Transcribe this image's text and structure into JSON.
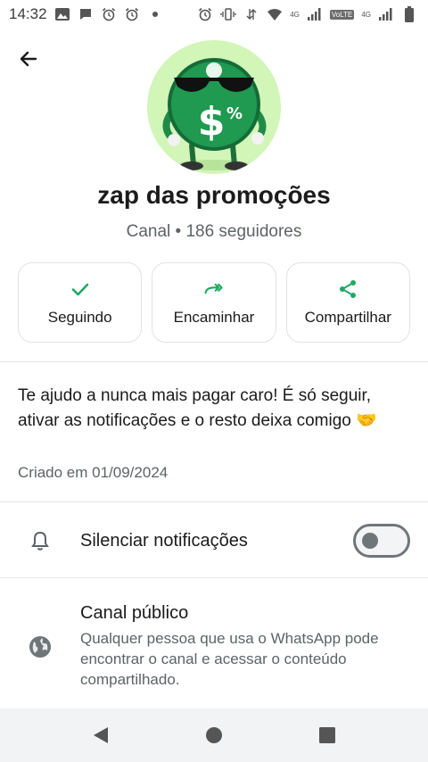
{
  "status_bar": {
    "time": "14:32",
    "network_left": "4G",
    "volte": "VoLTE",
    "network_right": "4G"
  },
  "channel": {
    "name": "zap das promoções",
    "meta": "Canal • 186 seguidores",
    "description": "Te ajudo a nunca mais pagar caro! É só seguir, ativar as notificações e o resto deixa comigo 🤝",
    "created": "Criado em 01/09/2024"
  },
  "actions": {
    "following_label": "Seguindo",
    "forward_label": "Encaminhar",
    "share_label": "Compartilhar"
  },
  "mute": {
    "label": "Silenciar notificações",
    "enabled": false
  },
  "public": {
    "title": "Canal público",
    "description": "Qualquer pessoa que usa o WhatsApp pode encontrar o canal e acessar o conteúdo compartilhado."
  },
  "icons": {
    "back": "arrow-left-icon",
    "following": "check-icon",
    "forward": "double-forward-icon",
    "share": "share-icon",
    "mute": "bell-icon",
    "public": "globe-icon"
  },
  "colors": {
    "accent": "#1daa61",
    "secondary_text": "#5e6366",
    "avatar_bg": "#d2f5b8"
  }
}
